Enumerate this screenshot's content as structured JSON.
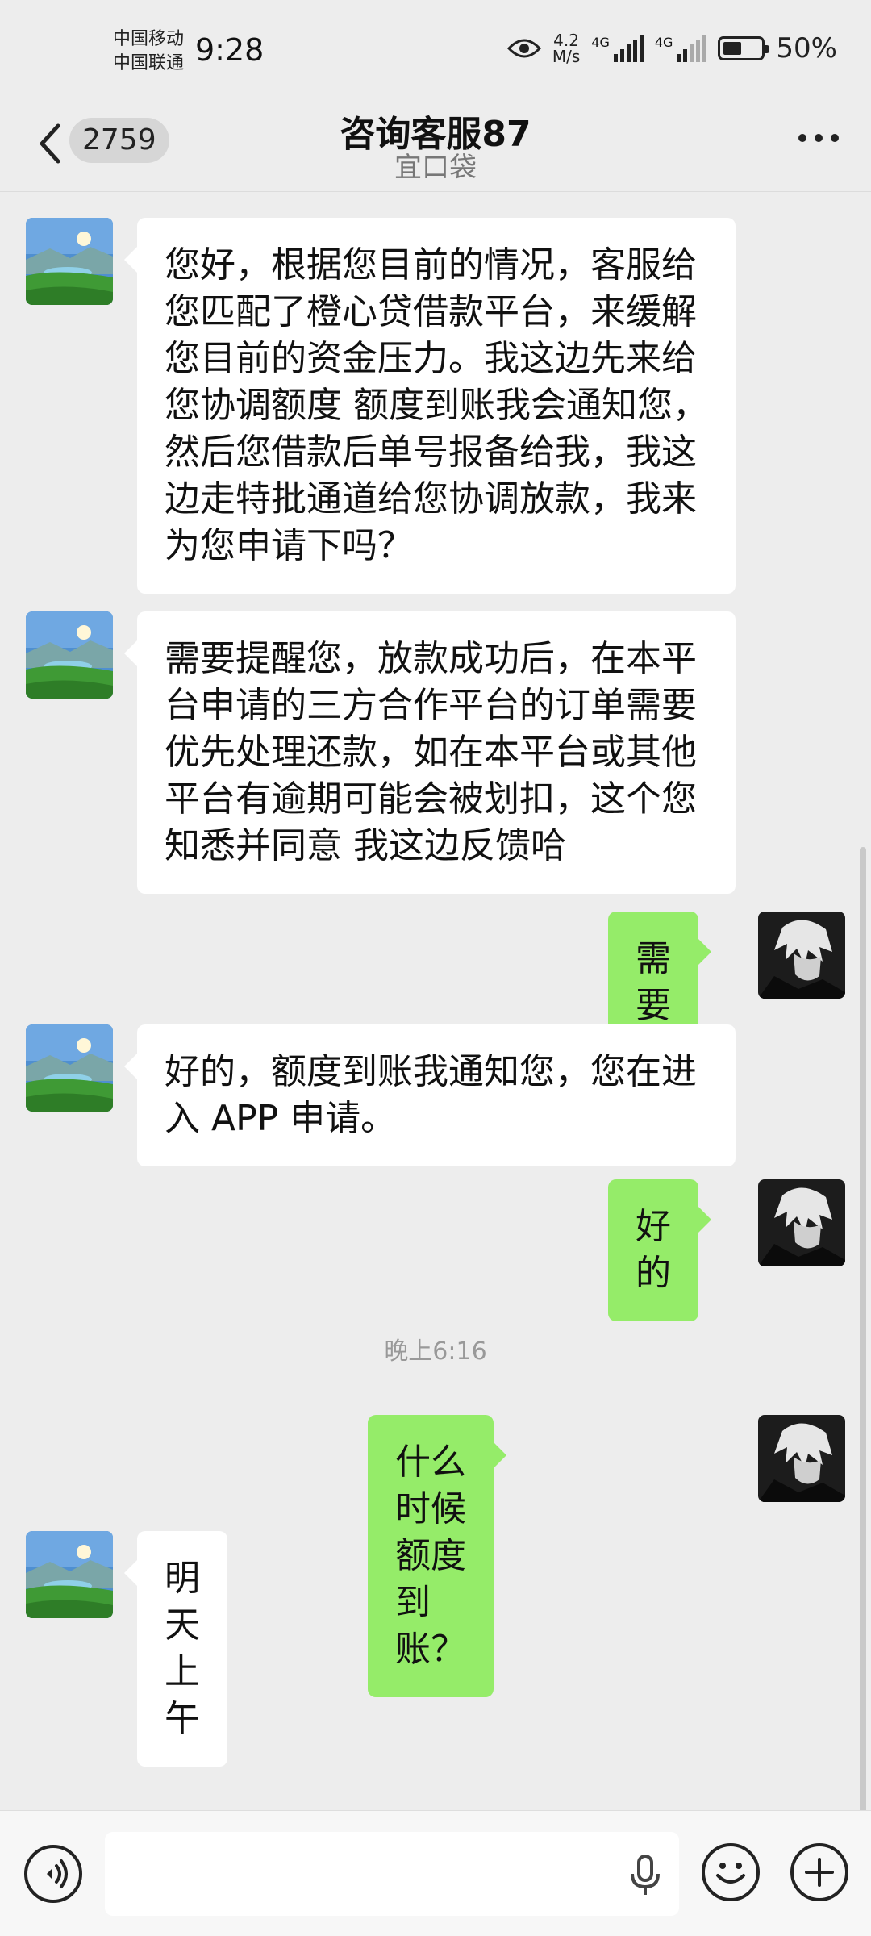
{
  "status_bar": {
    "carrier_1": "中国移动",
    "carrier_2": "中国联通",
    "time": "9:28",
    "net_speed_value": "4.2",
    "net_speed_unit": "M/s",
    "signal_1_label": "4G",
    "signal_2_label": "4G",
    "battery_text": "50%",
    "battery_level": 0.5
  },
  "header": {
    "unread_count": "2759",
    "title": "咨询客服87",
    "subtitle": "宜口袋"
  },
  "messages": [
    {
      "side": "left",
      "text": "您好，根据您目前的情况，客服给\n您匹配了橙心贷借款平台，来缓解\n您目前的资金压力。我这边先来给\n您协调额度 额度到账我会通知您，\n然后您借款后单号报备给我，我这\n边走特批通道给您协调放款，我来\n为您申请下吗？"
    },
    {
      "side": "left",
      "text": "需要提醒您，放款成功后，在本平\n台申请的三方合作平台的订单需要\n优先处理还款，如在本平台或其他\n平台有逾期可能会被划扣，这个您\n知悉并同意 我这边反馈哈"
    },
    {
      "side": "right",
      "text": "需要"
    },
    {
      "side": "left",
      "text": "好的，额度到账我通知您，您在进\n入 APP 申请。"
    },
    {
      "side": "right",
      "text": "好的"
    },
    {
      "side": "right",
      "text": "什么时候额度到账？"
    },
    {
      "side": "left",
      "text": "明天上午"
    }
  ],
  "timestamp": "晚上6:16",
  "colors": {
    "background": "#ededed",
    "my_bubble": "#95ec69",
    "their_bubble": "#ffffff"
  },
  "icons": {
    "back": "chevron-left-icon",
    "more": "more-dots-icon",
    "voice": "voice-icon",
    "mic": "mic-icon",
    "emoji": "emoji-icon",
    "plus": "plus-icon",
    "eye": "eye-icon"
  }
}
